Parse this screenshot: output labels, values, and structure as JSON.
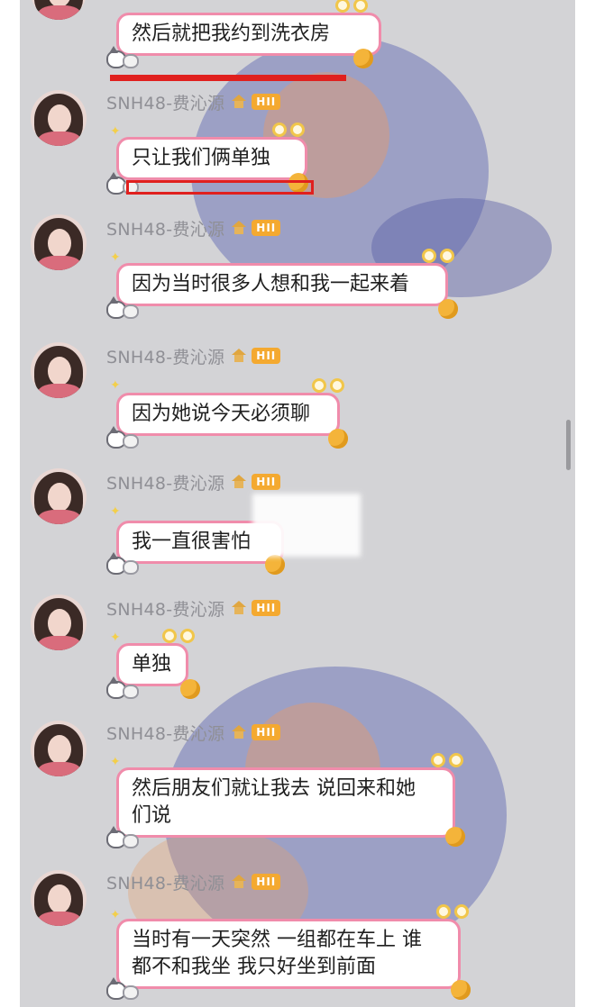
{
  "chat": {
    "messages": [
      {
        "sender": "",
        "badge": "",
        "lines": [
          "然后就把我约到洗衣房"
        ]
      },
      {
        "sender": "SNH48-费沁源",
        "badge": "HII",
        "lines": [
          "只让我们俩单独"
        ]
      },
      {
        "sender": "SNH48-费沁源",
        "badge": "HII",
        "lines": [
          "因为当时很多人想和我一起来着"
        ]
      },
      {
        "sender": "SNH48-费沁源",
        "badge": "HII",
        "lines": [
          "因为她说今天必须聊"
        ]
      },
      {
        "sender": "SNH48-费沁源",
        "badge": "HII",
        "lines": [
          "我一直很害怕"
        ]
      },
      {
        "sender": "SNH48-费沁源",
        "badge": "HII",
        "lines": [
          "单独"
        ]
      },
      {
        "sender": "SNH48-费沁源",
        "badge": "HII",
        "lines": [
          "然后朋友们就让我去 说回来和她",
          "们说"
        ]
      },
      {
        "sender": "SNH48-费沁源",
        "badge": "HII",
        "lines": [
          "当时有一天突然 一组都在车上 谁",
          "都不和我坐 我只好坐到前面"
        ]
      }
    ]
  },
  "icons": {
    "avatar": "user-avatar",
    "house": "house-icon",
    "eyes": "bubble-eyes-decoration",
    "yarn": "yarn-ball-decoration",
    "cat": "cat-decoration",
    "star": "sparkle-icon"
  },
  "colors": {
    "chat_background": "#d3d3d6",
    "bubble_border": "#f08cab",
    "badge": "#f4a930",
    "annotation_red": "#e0201e",
    "sender_text": "#8f8f95"
  }
}
